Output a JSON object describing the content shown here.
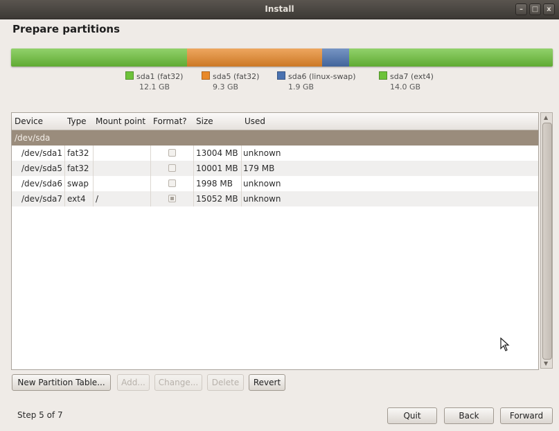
{
  "window": {
    "title": "Install",
    "controls": [
      "–",
      "□",
      "x"
    ]
  },
  "page": {
    "heading": "Prepare partitions"
  },
  "partition_bar": {
    "segments": [
      {
        "name": "sda1",
        "size_gb": 12.1,
        "color": "#6dc23a"
      },
      {
        "name": "sda5",
        "size_gb": 9.3,
        "color": "#e8892a"
      },
      {
        "name": "sda6",
        "size_gb": 1.9,
        "color": "#4a72b0"
      },
      {
        "name": "sda7",
        "size_gb": 14.0,
        "color": "#6dc23a"
      }
    ]
  },
  "legend": [
    {
      "label": "sda1 (fat32)",
      "size": "12.1 GB",
      "color": "#6dc23a"
    },
    {
      "label": "sda5 (fat32)",
      "size": "9.3 GB",
      "color": "#e8892a"
    },
    {
      "label": "sda6 (linux-swap)",
      "size": "1.9 GB",
      "color": "#4a72b0"
    },
    {
      "label": "sda7 (ext4)",
      "size": "14.0 GB",
      "color": "#6dc23a"
    }
  ],
  "table": {
    "columns": [
      "Device",
      "Type",
      "Mount point",
      "Format?",
      "Size",
      "Used"
    ],
    "group": "/dev/sda",
    "rows": [
      {
        "device": "/dev/sda1",
        "type": "fat32",
        "mount": "",
        "format": false,
        "size": "13004 MB",
        "used": "unknown"
      },
      {
        "device": "/dev/sda5",
        "type": "fat32",
        "mount": "",
        "format": false,
        "size": "10001 MB",
        "used": "179 MB"
      },
      {
        "device": "/dev/sda6",
        "type": "swap",
        "mount": "",
        "format": false,
        "size": "1998 MB",
        "used": "unknown"
      },
      {
        "device": "/dev/sda7",
        "type": "ext4",
        "mount": "/",
        "format": true,
        "size": "15052 MB",
        "used": "unknown"
      }
    ]
  },
  "buttons": {
    "new_partition_table": "New Partition Table...",
    "add": "Add...",
    "change": "Change...",
    "delete": "Delete",
    "revert": "Revert",
    "quit": "Quit",
    "back": "Back",
    "forward": "Forward"
  },
  "footer": {
    "step": "Step 5 of 7"
  },
  "colors": {
    "group_row": "#9a8c7c",
    "titlebar": "#4a4641"
  }
}
